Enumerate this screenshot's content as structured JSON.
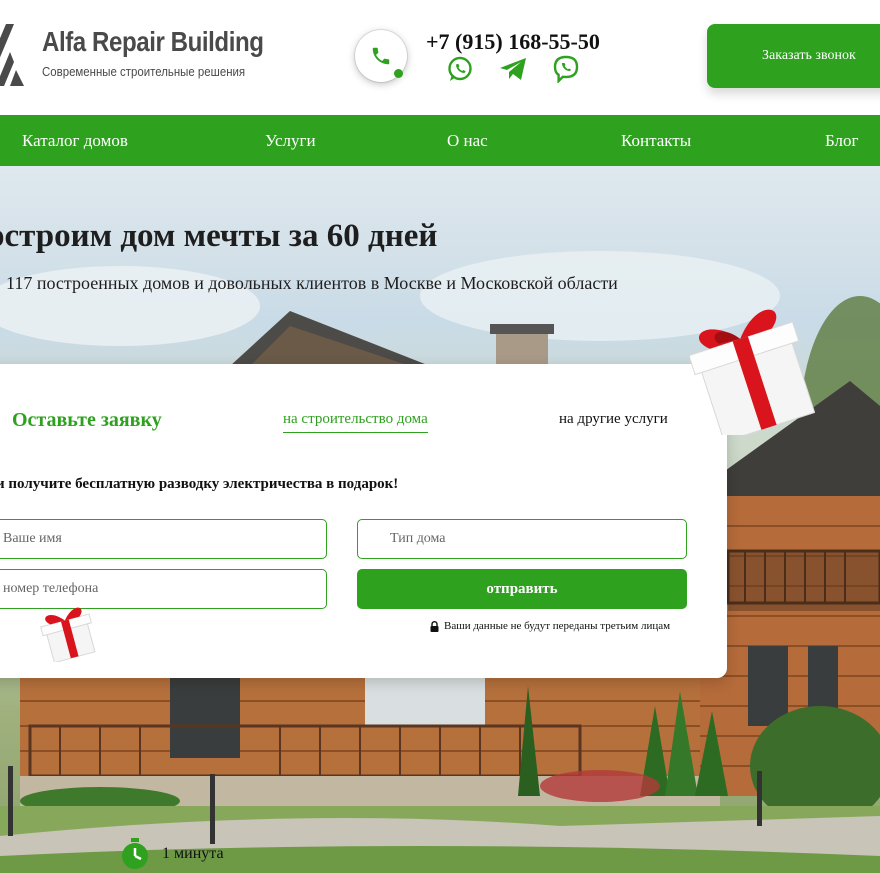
{
  "header": {
    "logo_title": "Alfa Repair Building",
    "logo_subtitle": "Современные строительные решения",
    "phone": "+7 (915) 168-55-50",
    "callback_label": "Заказать звонок",
    "messengers": [
      "whatsapp-icon",
      "telegram-icon",
      "viber-icon"
    ]
  },
  "nav": {
    "items": [
      {
        "label": "Каталог домов"
      },
      {
        "label": "Услуги"
      },
      {
        "label": "О нас"
      },
      {
        "label": "Контакты"
      },
      {
        "label": "Блог"
      }
    ]
  },
  "hero": {
    "title": "остроим дом мечты за 60 дней",
    "subtitle": "117 построенных домов и довольных клиентов в Москве и Московской области"
  },
  "form": {
    "title": "Оставьте заявку",
    "tabs": [
      {
        "label": "на строительство дома",
        "active": true
      },
      {
        "label": "на другие услуги",
        "active": false
      }
    ],
    "promo": "и получите бесплатную разводку электричества в подарок!",
    "name_placeholder": "Ваше имя",
    "phone_placeholder": "номер телефона",
    "house_type_placeholder": "Тип дома",
    "submit_label": "отправить",
    "privacy_note": "Ваши данные не будут переданы третьим лицам"
  },
  "timer": {
    "text": "1 минута"
  },
  "colors": {
    "accent": "#2ea11f",
    "gift_red": "#d9141c",
    "text": "#1a1a1a"
  }
}
